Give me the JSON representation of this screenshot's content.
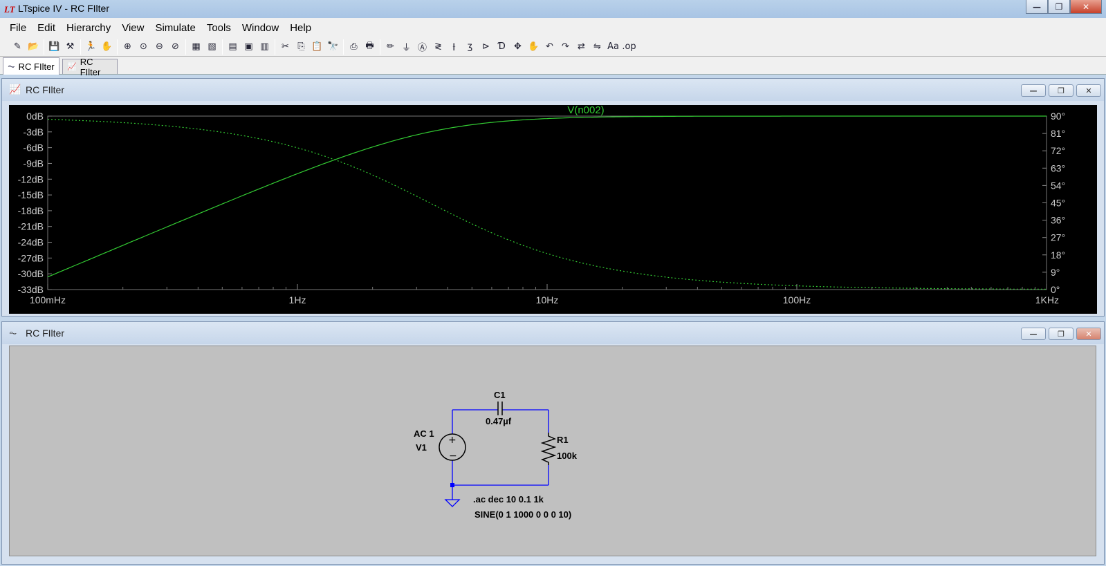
{
  "window": {
    "title": "LTspice IV - RC FIlter",
    "app_icon": "ltspice-logo-icon"
  },
  "menu": [
    "File",
    "Edit",
    "Hierarchy",
    "View",
    "Simulate",
    "Tools",
    "Window",
    "Help"
  ],
  "toolbar_icons": [
    "new-schematic-icon",
    "open-icon",
    "save-icon",
    "control-panel-icon",
    "run-icon",
    "halt-icon",
    "zoom-in-icon",
    "zoom-pan-icon",
    "zoom-out-icon",
    "zoom-cancel-icon",
    "plot-settings-icon",
    "autorange-icon",
    "tile-horizontal-icon",
    "cascade-icon",
    "close-all-icon",
    "cut-icon",
    "copy-icon",
    "paste-icon",
    "find-icon",
    "print-setup-icon",
    "print-icon",
    "draw-wire-icon",
    "ground-icon",
    "label-net-icon",
    "resistor-icon",
    "capacitor-icon",
    "inductor-icon",
    "diode-icon",
    "component-icon",
    "move-icon",
    "drag-icon",
    "undo-icon",
    "redo-icon",
    "rotate-icon",
    "mirror-icon",
    "text-icon",
    "spice-directive-icon"
  ],
  "toolbar_glyphs": [
    "✎",
    "📂",
    "💾",
    "⚒",
    "🏃",
    "✋",
    "⊕",
    "⊙",
    "⊖",
    "⊘",
    "▦",
    "▧",
    "▤",
    "▣",
    "▥",
    "✂",
    "⎘",
    "📋",
    "🔭",
    "⎙",
    "🖶",
    "✏",
    "⏚",
    "Ⓐ",
    "≷",
    "⫲",
    "ʒ",
    "⊳",
    "Ɗ",
    "✥",
    "✋",
    "↶",
    "↷",
    "⇄",
    "⇋",
    "Aa",
    ".op"
  ],
  "tabs": [
    {
      "label": "RC FIlter",
      "icon": "schematic-icon",
      "glyph": "⏦",
      "active": true
    },
    {
      "label": "RC FIlter",
      "icon": "waveform-icon",
      "glyph": "📈",
      "active": false
    }
  ],
  "plot_window": {
    "title": "RC FIlter",
    "icon": "waveform-icon",
    "glyph": "📈"
  },
  "schematic_window": {
    "title": "RC FIlter",
    "icon": "schematic-icon",
    "glyph": "⏦"
  },
  "window_controls": {
    "minimize": "—",
    "restore": "❐",
    "close": "✕"
  },
  "chart_data": {
    "type": "line",
    "title": "V(n002)",
    "x_scale": "log",
    "x_range": [
      0.1,
      1000
    ],
    "x_ticks": [
      {
        "value": 0.1,
        "label": "100mHz"
      },
      {
        "value": 1,
        "label": "1Hz"
      },
      {
        "value": 10,
        "label": "10Hz"
      },
      {
        "value": 100,
        "label": "100Hz"
      },
      {
        "value": 1000,
        "label": "1KHz"
      }
    ],
    "y_left": {
      "range": [
        -33,
        0
      ],
      "ticks": [
        0,
        -3,
        -6,
        -9,
        -12,
        -15,
        -18,
        -21,
        -24,
        -27,
        -30,
        -33
      ],
      "labels": [
        "0dB",
        "-3dB",
        "-6dB",
        "-9dB",
        "-12dB",
        "-15dB",
        "-18dB",
        "-21dB",
        "-24dB",
        "-27dB",
        "-30dB",
        "-33dB"
      ]
    },
    "y_right": {
      "range": [
        0,
        90
      ],
      "ticks": [
        90,
        81,
        72,
        63,
        54,
        45,
        36,
        27,
        18,
        9,
        0
      ],
      "labels": [
        "90°",
        "81°",
        "72°",
        "63°",
        "54°",
        "45°",
        "36°",
        "27°",
        "18°",
        "9°",
        "0°"
      ]
    },
    "background": "#000000",
    "trace_color": "#33cc33",
    "series": [
      {
        "kind": "magnitude_db",
        "style": "solid",
        "cutoff_hz": 3.386
      },
      {
        "kind": "phase_deg",
        "style": "dashed",
        "cutoff_hz": 3.386
      }
    ]
  },
  "schematic": {
    "wire_color": "#0000ff",
    "components": {
      "C1": {
        "name": "C1",
        "value": "0.47µf"
      },
      "R1": {
        "name": "R1",
        "value": "100k"
      },
      "V1": {
        "name": "V1",
        "value": "AC 1"
      }
    },
    "directives": [
      ".ac dec 10 0.1 1k",
      "SINE(0 1 1000 0 0 0 10)"
    ]
  },
  "colors": {
    "titlebar": "#b9d1ea",
    "plot_bg": "#000000",
    "trace": "#33cc33",
    "schematic_bg": "#c0c0c0",
    "wire": "#0000ff"
  }
}
